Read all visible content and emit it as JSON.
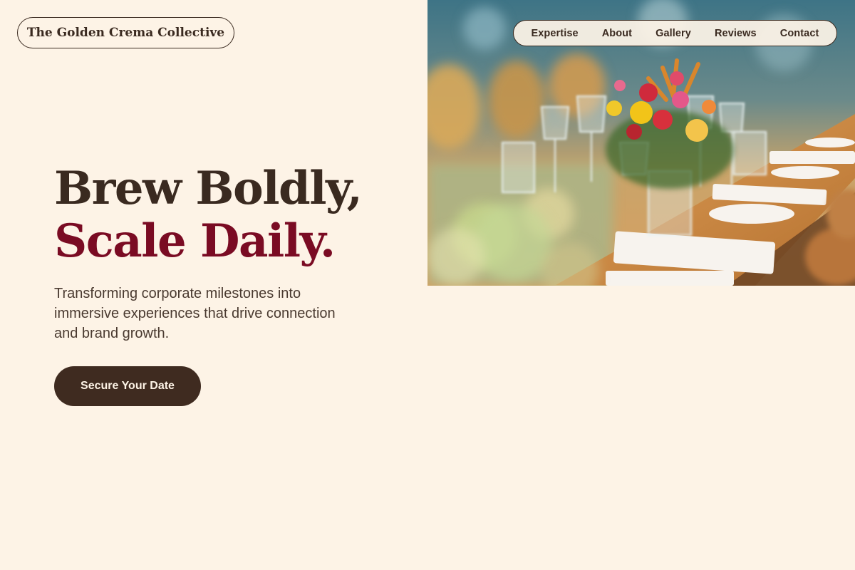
{
  "brand": {
    "name": "The Golden Crema Collective"
  },
  "nav": {
    "items": [
      {
        "label": "Expertise"
      },
      {
        "label": "About"
      },
      {
        "label": "Gallery"
      },
      {
        "label": "Reviews"
      },
      {
        "label": "Contact"
      }
    ]
  },
  "hero": {
    "headline_line1": "Brew Boldly,",
    "headline_line2": "Scale Daily.",
    "subtitle": "Transforming corporate milestones into immersive experiences that drive connection and brand growth.",
    "cta_label": "Secure Your Date",
    "image_description": "banquet-table-photo"
  },
  "colors": {
    "background": "#fdf3e6",
    "text_dark": "#3a2a20",
    "accent": "#7a0b23",
    "cta_bg": "#3f2b20"
  }
}
